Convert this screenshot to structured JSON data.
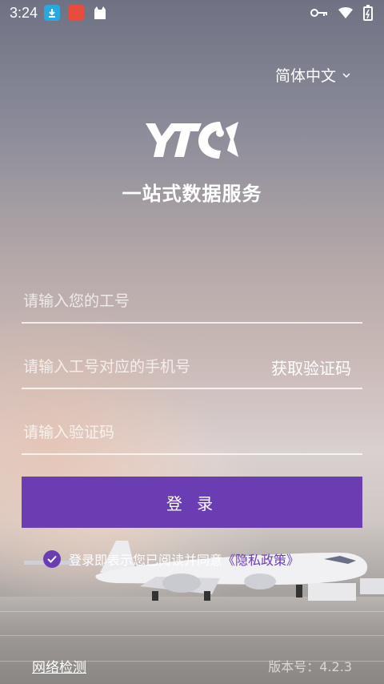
{
  "status_bar": {
    "time": "3:24"
  },
  "language": {
    "label": "简体中文"
  },
  "brand": {
    "slogan": "一站式数据服务"
  },
  "form": {
    "employee_id_placeholder": "请输入您的工号",
    "phone_placeholder": "请输入工号对应的手机号",
    "get_code_label": "获取验证码",
    "code_placeholder": "请输入验证码",
    "login_label": "登 录"
  },
  "agreement": {
    "text": "登录即表示您已阅读并同意",
    "policy_link": "《隐私政策》",
    "checked": true
  },
  "footer": {
    "network_check": "网络检测",
    "version": "版本号：4.2.3"
  },
  "colors": {
    "accent": "#6a3db3"
  }
}
